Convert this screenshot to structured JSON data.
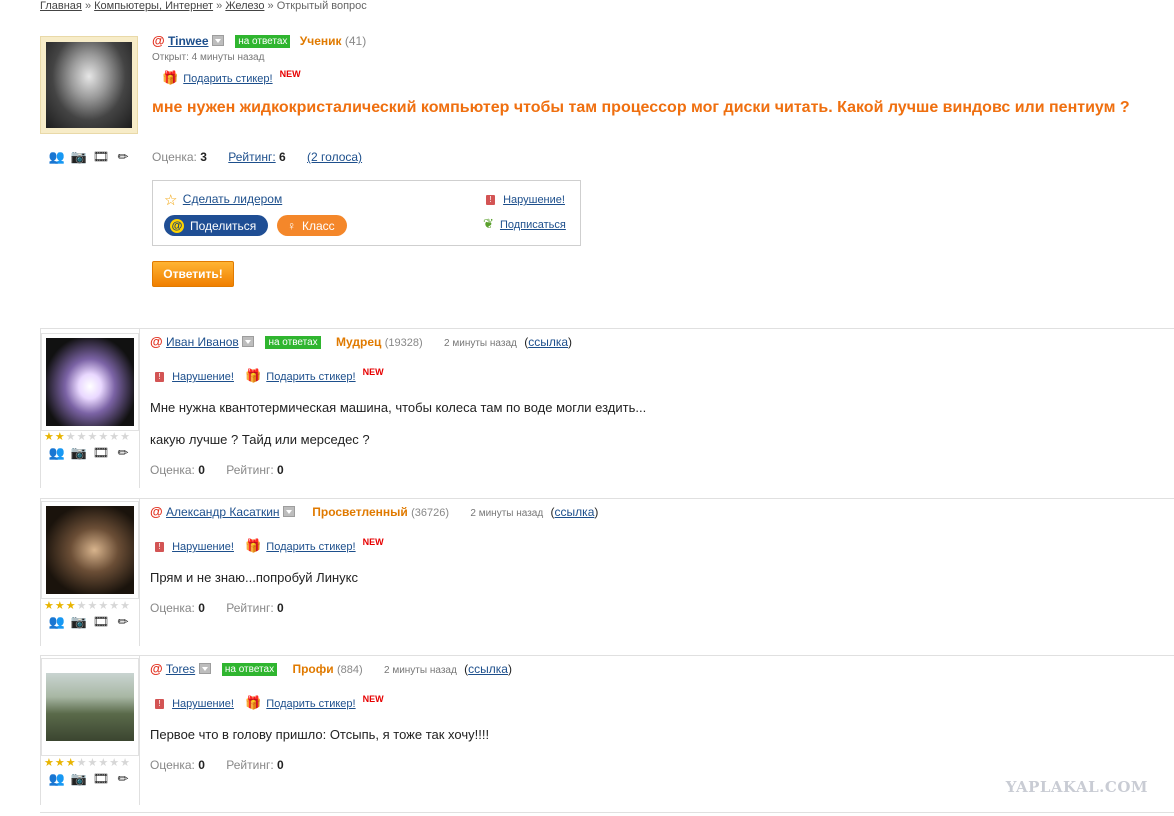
{
  "breadcrumb": {
    "home": "Главная",
    "sep": "»",
    "cat": "Компьютеры, Интернет",
    "sub": "Железо",
    "current": "Открытый вопрос"
  },
  "labels": {
    "rating_label": "Оценка:",
    "rating2_label": "Рейтинг:",
    "gift": "Подарить стикер!",
    "new": "NEW",
    "report": "Нарушение!",
    "link": "ссылка",
    "onans": "на ответах"
  },
  "question": {
    "author": "Tinwee",
    "rank": "Ученик",
    "points": "(41)",
    "opened": "Открыт: 4 минуты назад",
    "title": "мне нужен жидкокристалический компьютер чтобы там процессор мог диски читать. Какой лучше виндовс или пентиум ?",
    "score": "3",
    "rating": "6",
    "votes": "(2 голоса)",
    "make_leader": "Сделать лидером",
    "share": "Поделиться",
    "klass": "Класс",
    "report": "Нарушение!",
    "subscribe": "Подписаться",
    "answer_btn": "Ответить!"
  },
  "answers": [
    {
      "author": "Иван Иванов",
      "rank": "Мудрец",
      "points": "(19328)",
      "time": "2 минуты назад",
      "text1": "Мне нужна квантотермическая машина, чтобы колеса там по воде могли ездить...",
      "text2": "какую лучше ? Тайд или мерседес ?",
      "score": "0",
      "rating": "0",
      "stars": 2
    },
    {
      "author": "Александр Касаткин",
      "rank": "Просветленный",
      "points": "(36726)",
      "time": "2 минуты назад",
      "text1": "Прям и не знаю...попробуй Линукс",
      "score": "0",
      "rating": "0",
      "stars": 3
    },
    {
      "author": "Tores",
      "rank": "Профи",
      "points": "(884)",
      "time": "2 минуты назад",
      "text1": "Первое что в голову пришло: Отсыпь, я тоже так хочу!!!!",
      "score": "0",
      "rating": "0",
      "stars": 3
    }
  ],
  "watermark": "YAPLAKAL.COM",
  "icons": [
    "friend-icon",
    "photo-icon",
    "video-icon",
    "blog-icon",
    "star-icon",
    "gift-icon",
    "warning-icon",
    "subscribe-icon",
    "mail-at-icon",
    "ok-icon"
  ]
}
